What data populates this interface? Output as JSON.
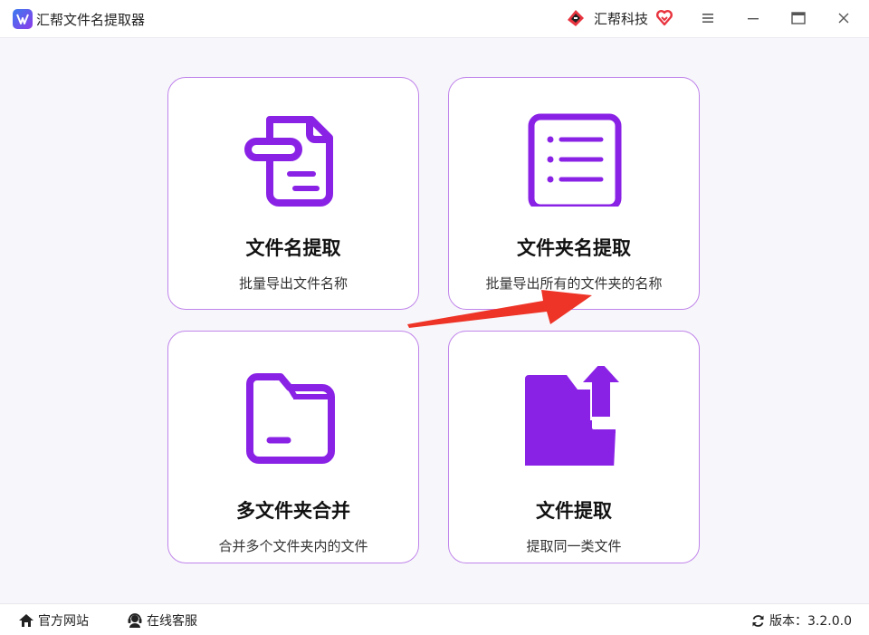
{
  "app": {
    "title": "汇帮文件名提取器",
    "brand": "汇帮科技"
  },
  "colors": {
    "accent": "#8a22e6",
    "card_border": "#c084ea",
    "arrow": "#ee3327",
    "brand_red": "#e8343f"
  },
  "icons": {
    "app": "app-logo-icon",
    "brand": "brand-logo-icon",
    "heart": "heart-icon",
    "menu": "menu-icon",
    "minimize": "minimize-icon",
    "maximize": "maximize-icon",
    "close": "close-icon",
    "card1": "document-icon",
    "card2": "list-icon",
    "card3": "folder-icon",
    "card4": "folder-upload-icon",
    "home": "home-icon",
    "service": "headset-icon",
    "refresh": "refresh-icon"
  },
  "cards": [
    {
      "title": "文件名提取",
      "desc": "批量导出文件名称"
    },
    {
      "title": "文件夹名提取",
      "desc": "批量导出所有的文件夹的名称"
    },
    {
      "title": "多文件夹合并",
      "desc": "合并多个文件夹内的文件"
    },
    {
      "title": "文件提取",
      "desc": "提取同一类文件"
    }
  ],
  "footer": {
    "site": "官方网站",
    "service": "在线客服",
    "version": "版本：3.2.0.0"
  }
}
